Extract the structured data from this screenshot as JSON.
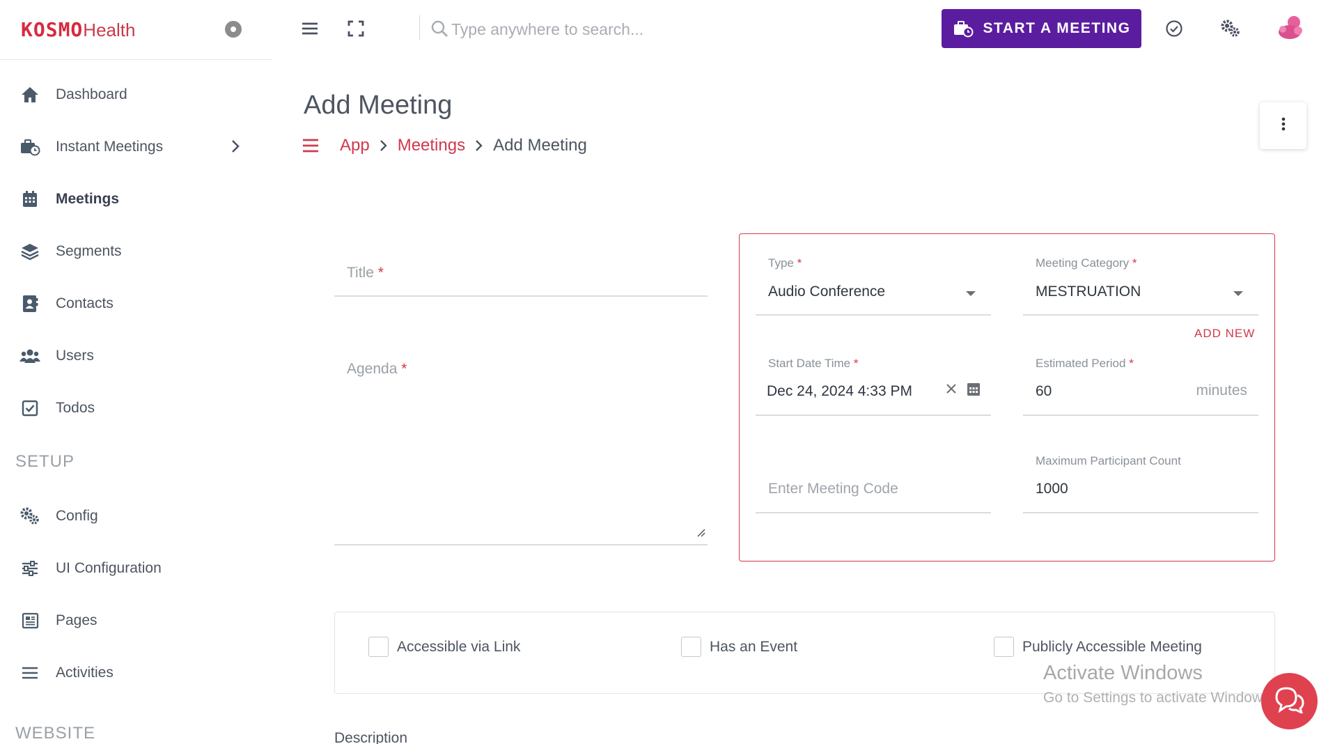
{
  "brand": {
    "name_bold": "KOSMO",
    "name_light": "Health"
  },
  "sidebar": {
    "items": [
      {
        "label": "Dashboard",
        "icon": "home-icon"
      },
      {
        "label": "Instant Meetings",
        "icon": "briefcase-clock-icon"
      },
      {
        "label": "Meetings",
        "icon": "calendar-icon"
      },
      {
        "label": "Segments",
        "icon": "layers-icon"
      },
      {
        "label": "Contacts",
        "icon": "contact-book-icon"
      },
      {
        "label": "Users",
        "icon": "users-icon"
      },
      {
        "label": "Todos",
        "icon": "check-square-icon"
      }
    ],
    "setup_section": "SETUP",
    "setup_items": [
      {
        "label": "Config",
        "icon": "gears-icon"
      },
      {
        "label": "UI Configuration",
        "icon": "sliders-icon"
      },
      {
        "label": "Pages",
        "icon": "newspaper-icon"
      },
      {
        "label": "Activities",
        "icon": "list-icon"
      }
    ],
    "website_section": "WEBSITE",
    "active": "Meetings"
  },
  "topbar": {
    "search_placeholder": "Type anywhere to search...",
    "start_meeting_label": "START A MEETING",
    "accent_color": "#5b1da0"
  },
  "page": {
    "title": "Add Meeting",
    "breadcrumb": [
      "App",
      "Meetings",
      "Add Meeting"
    ]
  },
  "form": {
    "title_label": "Title",
    "agenda_label": "Agenda",
    "required_mark": "*",
    "type_label": "Type",
    "type_value": "Audio Conference",
    "category_label": "Meeting Category",
    "category_value": "MESTRUATION",
    "add_new_label": "ADD NEW",
    "start_label": "Start Date Time",
    "start_value": "Dec 24, 2024 4:33 PM",
    "period_label": "Estimated Period",
    "period_value": "60",
    "period_suffix": "minutes",
    "code_placeholder": "Enter Meeting Code",
    "max_label": "Maximum Participant Count",
    "max_value": "1000",
    "checkboxes": [
      {
        "label": "Accessible via Link",
        "checked": false
      },
      {
        "label": "Has an Event",
        "checked": false
      },
      {
        "label": "Publicly Accessible Meeting",
        "checked": false
      }
    ],
    "description_label": "Description",
    "error_color": "#d0394d"
  },
  "watermark": {
    "title": "Activate Windows",
    "subtitle": "Go to Settings to activate Windows."
  }
}
